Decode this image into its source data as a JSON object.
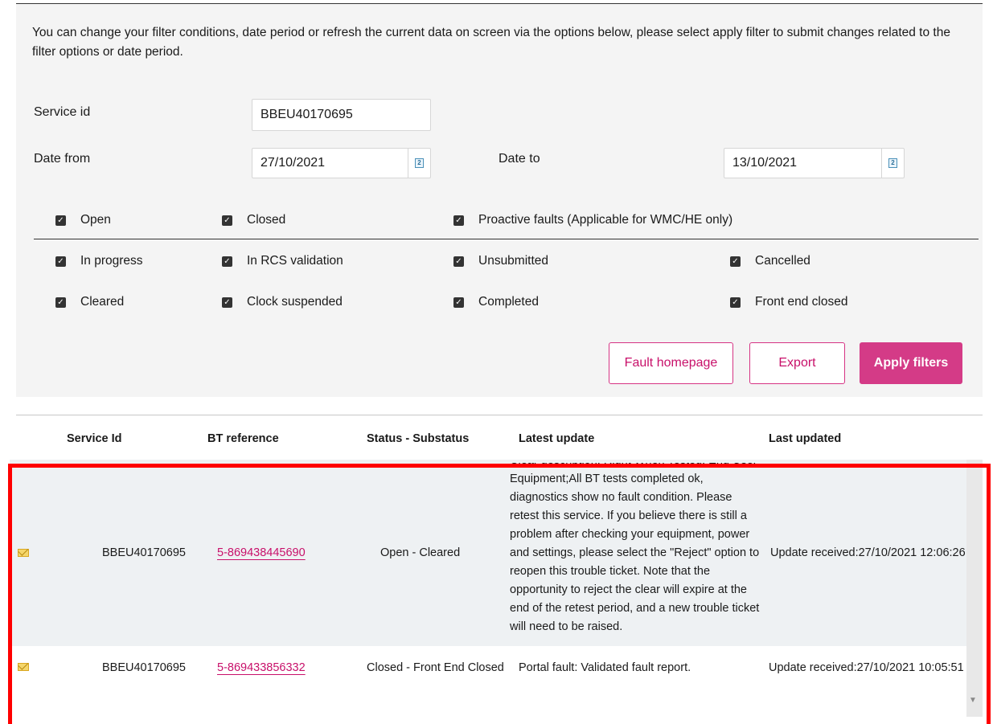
{
  "filters": {
    "intro_text": "You can change your filter conditions, date period or refresh the current data on screen via the options below, please select apply filter to submit changes related to the filter options or date period.",
    "service_id_label": "Service id",
    "service_id_value": "BBEU40170695",
    "date_from_label": "Date from",
    "date_from_value": "27/10/2021",
    "date_to_label": "Date to",
    "date_to_value": "13/10/2021",
    "calendar_glyph": "2",
    "checkbox_glyph": "✓",
    "primary_checks": [
      "Open",
      "Closed",
      "Proactive faults (Applicable for WMC/HE only)"
    ],
    "status_checks_row1": [
      "In progress",
      "In RCS validation",
      "Unsubmitted",
      "Cancelled"
    ],
    "status_checks_row2": [
      "Cleared",
      "Clock suspended",
      "Completed",
      "Front end closed"
    ]
  },
  "actions": {
    "fault_homepage": "Fault homepage",
    "export": "Export",
    "apply_filters": "Apply filters"
  },
  "table": {
    "headers": {
      "service_id": "Service Id",
      "bt_reference": "BT reference",
      "status": "Status - Substatus",
      "latest_update": "Latest update",
      "last_updated": "Last updated"
    },
    "rows": [
      {
        "service_id": "BBEU40170695",
        "bt_reference": "5-869438445690",
        "status": "Open - Cleared",
        "latest_update": "Clear description: Right When Tested, End User Equipment;All BT tests completed ok, diagnostics show no fault condition. Please retest this service. If you believe there is still a problem after checking your equipment, power and settings, please select the \"Reject\" option to reopen this trouble ticket. Note that the opportunity to reject the clear will expire at the end of the retest period, and a new trouble ticket will need to be raised.",
        "last_updated": "Update received:27/10/2021 12:06:26"
      },
      {
        "service_id": "BBEU40170695",
        "bt_reference": "5-869433856332",
        "status": "Closed - Front End Closed",
        "latest_update": "Portal fault: Validated fault report.",
        "last_updated": "Update received:27/10/2021 10:05:51"
      }
    ]
  },
  "colors": {
    "accent": "#d43b87",
    "link": "#c8106a",
    "highlight": "#ff0000"
  }
}
